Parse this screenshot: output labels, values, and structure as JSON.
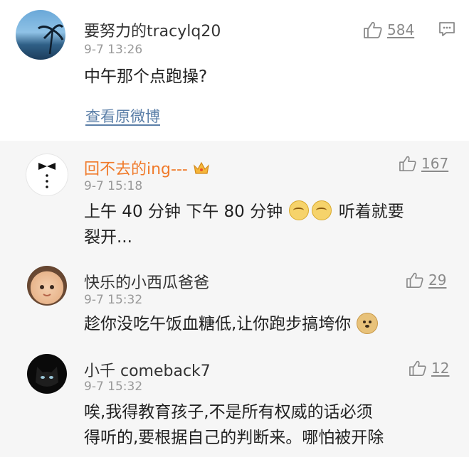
{
  "main_comment": {
    "username": "要努力的tracylq20",
    "time": "9-7 13:26",
    "text": "中午那个点跑操?",
    "likes": "584",
    "link": "查看原微博"
  },
  "replies": [
    {
      "username": "回不去的ing---",
      "time": "9-7 15:18",
      "likes": "167",
      "text_line1": "上午 40 分钟  下午 80 分钟",
      "text_line1_end": "听着就要",
      "text_line2": "裂开..."
    },
    {
      "username": "快乐的小西瓜爸爸",
      "time": "9-7 15:32",
      "likes": "29",
      "text": "趁你没吃午饭血糖低,让你跑步搞垮你"
    },
    {
      "username": "小千 comeback7",
      "time": "9-7 15:32",
      "likes": "12",
      "text_line1": "唉,我得教育孩子,不是所有权威的话必须",
      "text_line2": "得听的,要根据自己的判断来。哪怕被开除"
    }
  ],
  "colors": {
    "orange_name": "#f07a2a",
    "link": "#5b7fa8",
    "reply_bg": "#f6f6f6"
  },
  "icons": [
    "thumbs-up-icon",
    "comment-icon",
    "crown-badge-icon",
    "emoji-icon"
  ]
}
